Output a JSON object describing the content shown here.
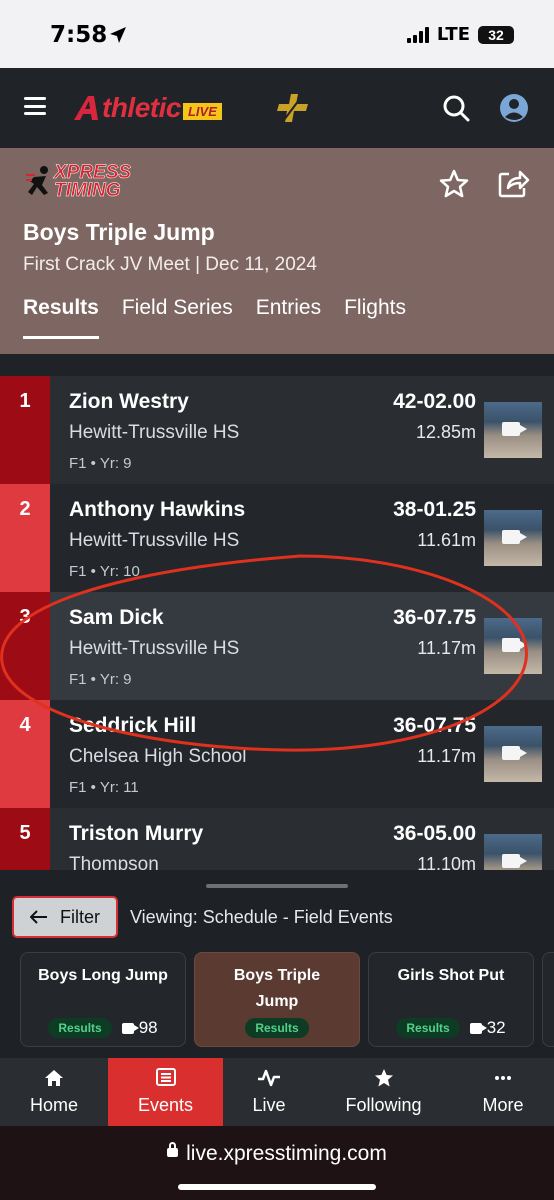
{
  "status_bar": {
    "time": "7:58",
    "network": "LTE",
    "battery": "32"
  },
  "app": {
    "brand_main": "thletic",
    "brand_badge": "LIVE"
  },
  "event": {
    "org_logo_line1": "XPRESS",
    "org_logo_line2": "TIMING",
    "title": "Boys Triple Jump",
    "subtitle": "First Crack JV Meet | Dec 11, 2024",
    "tabs": [
      {
        "label": "Results"
      },
      {
        "label": "Field Series"
      },
      {
        "label": "Entries"
      },
      {
        "label": "Flights"
      }
    ]
  },
  "results": [
    {
      "place": "1",
      "name": "Zion Westry",
      "school": "Hewitt-Trussville HS",
      "meta": "F1 • Yr: 9",
      "mark": "42-02.00",
      "metric": "12.85m"
    },
    {
      "place": "2",
      "name": "Anthony Hawkins",
      "school": "Hewitt-Trussville HS",
      "meta": "F1 • Yr: 10",
      "mark": "38-01.25",
      "metric": "11.61m"
    },
    {
      "place": "3",
      "name": "Sam Dick",
      "school": "Hewitt-Trussville HS",
      "meta": "F1 • Yr: 9",
      "mark": "36-07.75",
      "metric": "11.17m"
    },
    {
      "place": "4",
      "name": "Seddrick Hill",
      "school": "Chelsea High School",
      "meta": "F1 • Yr: 11",
      "mark": "36-07.75",
      "metric": "11.17m"
    },
    {
      "place": "5",
      "name": "Triston Murry",
      "school": "Thompson",
      "meta": "",
      "mark": "36-05.00",
      "metric": "11.10m"
    }
  ],
  "panel": {
    "filter_label": "Filter",
    "viewing_text": "Viewing: Schedule - Field Events",
    "cards": [
      {
        "title": "Boys Long Jump",
        "badge": "Results",
        "count": "98"
      },
      {
        "title": "Boys Triple Jump",
        "badge": "Results",
        "count": ""
      },
      {
        "title": "Girls Shot Put",
        "badge": "Results",
        "count": "32"
      }
    ]
  },
  "nav": [
    {
      "label": "Home"
    },
    {
      "label": "Events"
    },
    {
      "label": "Live"
    },
    {
      "label": "Following"
    },
    {
      "label": "More"
    }
  ],
  "browser": {
    "url": "live.xpresstiming.com"
  },
  "colors": {
    "accent_red": "#d9302f",
    "header_brown": "#7e6762",
    "place_dark": "#9d0c15",
    "annotation_red": "#e0311f"
  }
}
